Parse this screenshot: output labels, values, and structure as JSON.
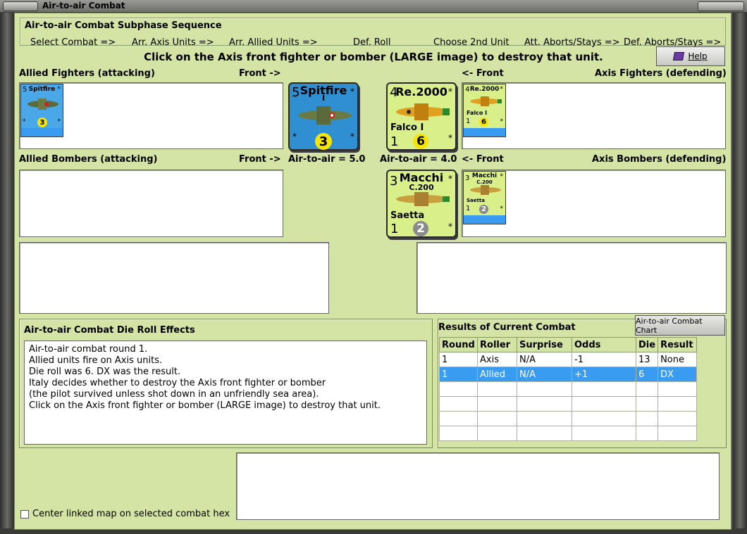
{
  "window": {
    "title": "Air-to-air Combat"
  },
  "sequence": {
    "title": "Air-to-air Combat Subphase Sequence",
    "steps": [
      "Select Combat =>",
      "Arr. Axis Units =>",
      "Arr. Allied Units =>",
      "Def. Roll",
      "Choose 2nd Unit",
      "Att. Aborts/Stays =>",
      "Def. Aborts/Stays =>"
    ]
  },
  "instruction": "Click on the Axis front fighter or bomber (LARGE image) to destroy that unit.",
  "help_label": "Help",
  "labels": {
    "allied_fighters": "Allied Fighters (attacking)",
    "allied_bombers": "Allied Bombers (attacking)",
    "front_right": "Front ->",
    "front_left": "<- Front",
    "axis_fighters": "Axis Fighters (defending)",
    "axis_bombers": "Axis Bombers (defending)",
    "allied_air": "Air-to-air = 5.0",
    "axis_air": "Air-to-air = 4.0"
  },
  "units": {
    "spitfire": {
      "name": "Spitfire",
      "variant": "I",
      "air": "5",
      "range": "3",
      "star": "*"
    },
    "re2000": {
      "name": "Re.2000",
      "nick": "Falco I",
      "air": "4",
      "def": "1",
      "range": "6",
      "star": "*"
    },
    "macchi": {
      "name": "Macchi",
      "model": "C.200",
      "nick": "Saetta",
      "air": "3",
      "def": "1",
      "range": "2",
      "star": "*"
    }
  },
  "die_effects": {
    "title": "Air-to-air Combat Die Roll Effects",
    "lines": [
      "Air-to-air combat round 1.",
      "Allied units fire on Axis units.",
      "Die roll was 6.  DX was the result.",
      "Italy decides whether to destroy the Axis front fighter or bomber",
      "(the pilot survived unless shot down in an unfriendly sea area).",
      "Click on the Axis front fighter or bomber (LARGE image) to destroy that unit."
    ]
  },
  "results": {
    "title": "Results of Current Combat",
    "chart_button": "Air-to-air Combat Chart",
    "headers": [
      "Round",
      "Roller",
      "Surprise",
      "Odds",
      "Die",
      "Result"
    ],
    "rows": [
      [
        "1",
        "Axis",
        "N/A",
        "-1",
        "13",
        "None"
      ],
      [
        "1",
        "Allied",
        "N/A",
        "+1",
        "6",
        "DX"
      ]
    ]
  },
  "center_map_label": "Center linked map on selected combat hex",
  "colors": {
    "panel_bg": "#d3e4a4",
    "chip_bg": "#d9f08a",
    "spitfire_bg": "#2f8fd0",
    "selected": "#3a9cf0",
    "die_yellow": "#f4e40a",
    "die_grey": "#8a8a8a"
  }
}
